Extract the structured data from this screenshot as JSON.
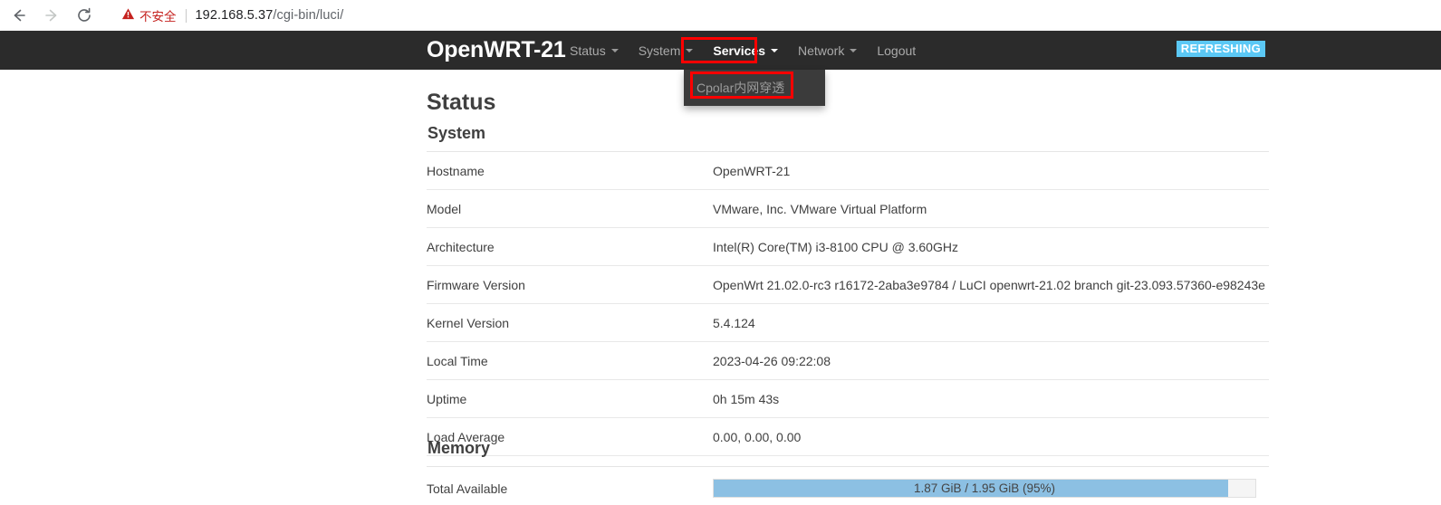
{
  "browser": {
    "back_icon": "back-arrow-icon",
    "forward_icon": "forward-arrow-icon",
    "reload_icon": "reload-icon",
    "security_warning_icon": "warning-triangle-icon",
    "security_label": "不安全",
    "url_host": "192.168.5.37",
    "url_path": "/cgi-bin/luci/",
    "url_full": "192.168.5.37/cgi-bin/luci/"
  },
  "header": {
    "brand": "OpenWRT-21",
    "menu": [
      {
        "label": "Status",
        "caret": true,
        "active": false
      },
      {
        "label": "System",
        "caret": true,
        "active": false
      },
      {
        "label": "Services",
        "caret": true,
        "active": true
      },
      {
        "label": "Network",
        "caret": true,
        "active": false
      },
      {
        "label": "Logout",
        "caret": false,
        "active": false
      }
    ],
    "refreshing_badge": "REFRESHING",
    "refreshing_badge_color": "#5bc8f5"
  },
  "services_dropdown": {
    "items": [
      {
        "label": "Cpolar内网穿透"
      }
    ]
  },
  "annotations": {
    "color": "#ff0000",
    "boxes": [
      {
        "target": "services-menu-item"
      },
      {
        "target": "cpolar-dropdown-item"
      }
    ]
  },
  "main": {
    "page_title": "Status",
    "sections": [
      {
        "heading": "System",
        "rows": [
          {
            "label": "Hostname",
            "value": "OpenWRT-21"
          },
          {
            "label": "Model",
            "value": "VMware, Inc. VMware Virtual Platform"
          },
          {
            "label": "Architecture",
            "value": "Intel(R) Core(TM) i3-8100 CPU @ 3.60GHz"
          },
          {
            "label": "Firmware Version",
            "value": "OpenWrt 21.02.0-rc3 r16172-2aba3e9784 / LuCI openwrt-21.02 branch git-23.093.57360-e98243e"
          },
          {
            "label": "Kernel Version",
            "value": "5.4.124"
          },
          {
            "label": "Local Time",
            "value": "2023-04-26 09:22:08"
          },
          {
            "label": "Uptime",
            "value": "0h 15m 43s"
          },
          {
            "label": "Load Average",
            "value": "0.00, 0.00, 0.00"
          }
        ]
      },
      {
        "heading": "Memory",
        "rows": [
          {
            "label": "Total Available",
            "progress": {
              "text": "1.87 GiB / 1.95 GiB (95%)",
              "percent": 95,
              "fill_color": "#8cc0e3"
            }
          }
        ]
      }
    ]
  }
}
